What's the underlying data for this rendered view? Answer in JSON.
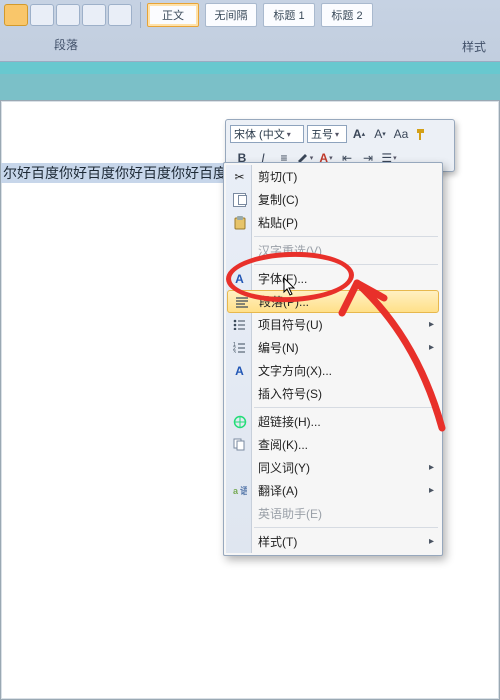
{
  "ribbon": {
    "styles": {
      "normal": "正文",
      "nospace": "无间隔",
      "h1": "标题 1",
      "h2": "标题 2"
    },
    "group_paragraph": "段落",
    "group_styles": "样式"
  },
  "mini_toolbar": {
    "font_name": "宋体 (中文",
    "font_size": "五号",
    "grow": "A",
    "shrink": "A"
  },
  "document": {
    "selected_text": "尔好百度你好百度你好百度你好百度你好百度你"
  },
  "context_menu": {
    "cut": "剪切(T)",
    "copy": "复制(C)",
    "paste": "粘贴(P)",
    "reconvert": "汉字重选(V)",
    "font": "字体(F)...",
    "paragraph": "段落(P)...",
    "bullets": "项目符号(U)",
    "numbering": "编号(N)",
    "textdir": "文字方向(X)...",
    "symbol": "插入符号(S)",
    "hyperlink": "超链接(H)...",
    "lookup": "查阅(K)...",
    "synonyms": "同义词(Y)",
    "translate": "翻译(A)",
    "ime": "英语助手(E)",
    "styles": "样式(T)"
  }
}
